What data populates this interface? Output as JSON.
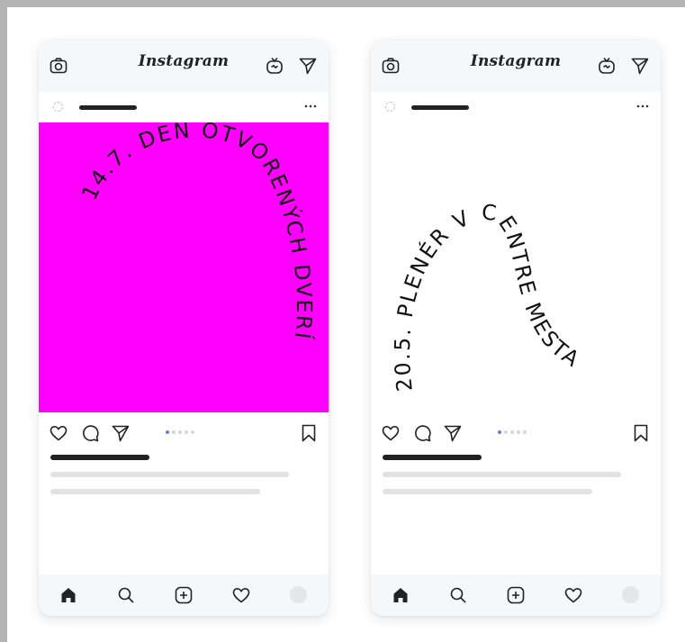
{
  "app": {
    "name": "Instagram"
  },
  "posts": [
    {
      "caption_art": "14.7. DEŇ OTVORENÝCH DVERÍ",
      "background_color": "#ff00ff",
      "text_color": "#111111",
      "carousel": {
        "count": 5,
        "active": 1
      }
    },
    {
      "caption_art": "20.5. PLENÉR V CENTRE MESTA",
      "background_color": "#ffffff",
      "text_color": "#111111",
      "carousel": {
        "count": 5,
        "active": 1
      }
    }
  ],
  "icons": {
    "top_left": "camera-icon",
    "top_right": [
      "igtv-icon",
      "direct-message-icon"
    ],
    "post_actions": [
      "heart-icon",
      "comment-icon",
      "share-icon",
      "bookmark-icon"
    ],
    "bottom_nav": [
      "home-icon",
      "search-icon",
      "add-post-icon",
      "activity-heart-icon",
      "profile-avatar"
    ]
  },
  "colors": {
    "accent_dot": "#5b86d6",
    "skeleton": "#e2e2e2",
    "dark_bar": "#222222"
  }
}
